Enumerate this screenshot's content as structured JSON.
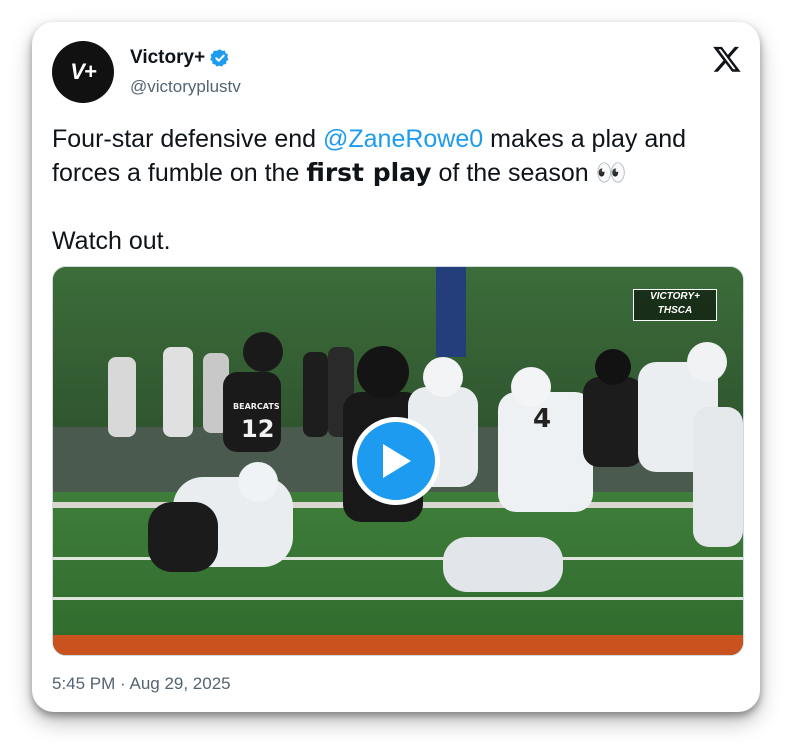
{
  "author": {
    "display_name": "Victory+",
    "handle": "@victoryplustv",
    "avatar_text": "V+",
    "verified_icon": "verified-badge-icon"
  },
  "tweet": {
    "text_part1": "Four-star defensive end ",
    "mention": "@ZaneRowe0",
    "text_part2": " makes a play and forces a fumble on the ",
    "bold_text": "first play",
    "text_part3": " of the season 👀",
    "line2": "Watch out."
  },
  "media": {
    "watermark_line1": "VICTORY+",
    "watermark_line2": "THSCA",
    "jersey_text": "BEARCATS",
    "jersey_number": "12",
    "opponent_number": "4",
    "play_icon": "play-icon"
  },
  "timestamp": "5:45 PM · Aug 29, 2025",
  "colors": {
    "accent": "#1d9bf0",
    "text": "#0f1419",
    "muted": "#536471"
  }
}
